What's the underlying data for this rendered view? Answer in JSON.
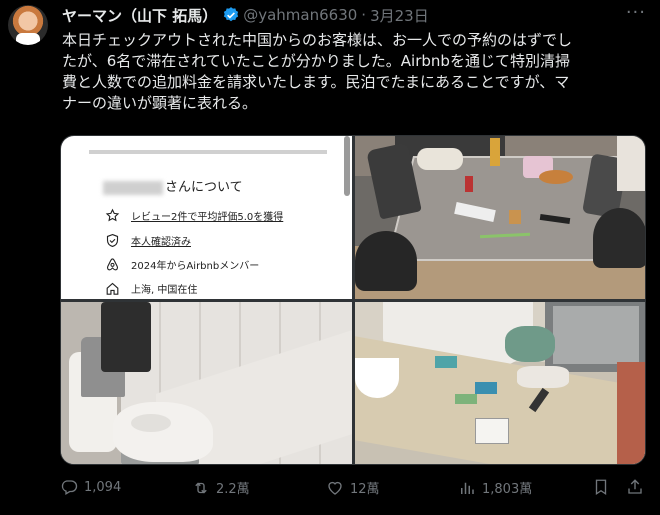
{
  "author": {
    "name": "ヤーマン（山下 拓馬）",
    "handle": "@yahman6630",
    "separator": "·",
    "date": "3月23日"
  },
  "more_label": "···",
  "tweet_lines": [
    "本日チェックアウトされた中国からのお客様は、お一人での予約のはずでし",
    "たが、6名で滞在されていたことが分かりました。Airbnbを通じて特別清掃",
    "費と人数での追加料金を請求いたします。民泊でたまにあることですが、マ",
    "ナーの違いが顕著に表れる。"
  ],
  "profile_card": {
    "name_suffix": "さんについて",
    "rows": [
      {
        "icon": "star-icon",
        "label": "レビュー2件で平均評価5.0を獲得",
        "underline": true
      },
      {
        "icon": "shield-check-icon",
        "label": "本人確認済み",
        "underline": true
      },
      {
        "icon": "airbnb-icon",
        "label": "2024年からAirbnbメンバー",
        "underline": false
      },
      {
        "icon": "home-icon",
        "label": "上海, 中国在住",
        "underline": false
      }
    ]
  },
  "actions": {
    "replies": "1,094",
    "reposts": "2.2萬",
    "likes": "12萬",
    "views": "1,803萬"
  },
  "colors": {
    "background": "#000000",
    "text": "#e7e9ea",
    "muted": "#71767b",
    "verified": "#1d9bf0"
  }
}
